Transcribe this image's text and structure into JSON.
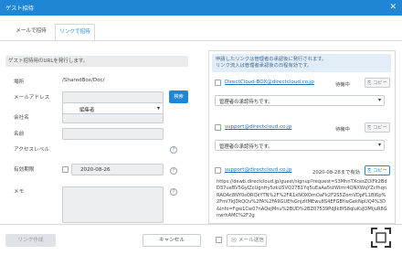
{
  "window": {
    "title": "ゲスト招待",
    "close": "✕"
  },
  "tabs": [
    {
      "label": "メールで招待"
    },
    {
      "label": "リンクで招待"
    }
  ],
  "form": {
    "info": "ゲスト招待用のURLを発行します。",
    "location_label": "場所",
    "location_value": "/SharedBox/Doc/",
    "email_label": "メールアドレス",
    "search_button": "検索",
    "company_label": "会社名",
    "name_label": "名前",
    "access_label": "アクセスレベル",
    "access_value": "編集者",
    "expiry_label": "有効期限",
    "expiry_value": "2020-08-26",
    "memo_label": "メモ"
  },
  "approvals": {
    "notice": "申請したリンクは管理者の承認後に発行されます。\nリンク流入は管理者承認後の日程有効です。",
    "items": [
      {
        "email": "DirectCloud-BOX@directcloud.co.jp",
        "status": "待機中",
        "copy": "コピー",
        "approver": "管理者の承認待ちです。",
        "checked": false
      },
      {
        "email": "support@directcloud.co.jp",
        "status": "待機中",
        "copy": "コピー",
        "approver": "管理者の承認待ちです。",
        "checked": false
      },
      {
        "email": "support@directcloud.co.jp",
        "status": "2020-08-28まで有効",
        "copy": "コピー",
        "checked": false,
        "url": "https://dewb.directcloud.jp/guest/signup?request=S3MhnTXcesZOlFk2BdD37ueBV5GyIZcUgnHy5zkU5VQ27B1Yq5uEaAa5stWlmr4QNXWqYZcfhqnRAOAc8NY0sORQkYTN%2F%2FR1xNOXOmOaFk2F2S5ZomVDpFL1BI6p%2FmI7kJDkQQv%2FA%2FA9GUEfsGnjzItMEwu8S4EFGBYwGekNpUQ4%3D&info=Fgw1Cw07nAQeJMnu%2BUD%2BZ07539PdJIk8fS8qIuKsJOMIjuR8GnwrhAMC%2F2g"
      }
    ]
  },
  "footer": {
    "link_create": "リンク作成",
    "cancel": "キャンセル",
    "mail_send": "メール送信"
  },
  "icons": {
    "help": "?",
    "checkbox": "checkbox-icon",
    "envelope": "envelope-icon",
    "expand": "expand-icon"
  },
  "colors": {
    "primary": "#1f86d6",
    "link": "#1f6fbf",
    "notice_bg": "#e3edf7"
  }
}
